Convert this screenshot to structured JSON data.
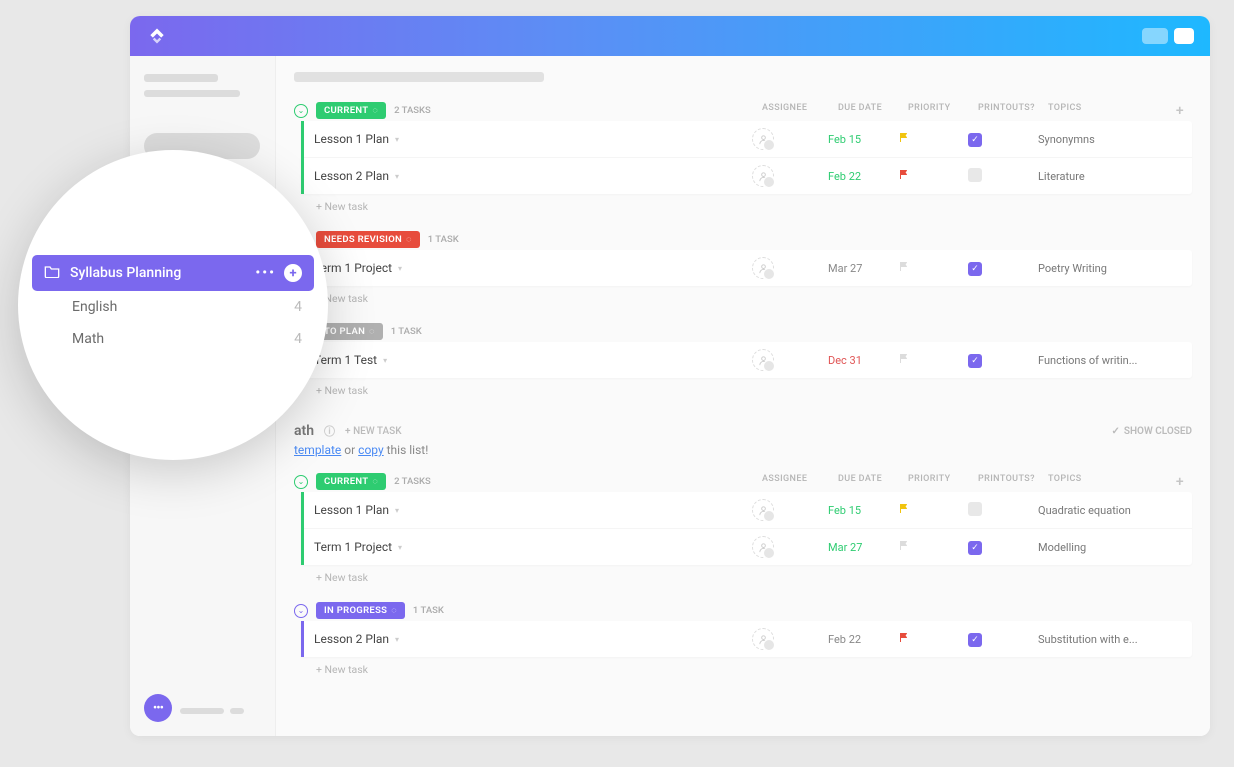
{
  "columns": {
    "assignee": "ASSIGNEE",
    "due_date": "DUE DATE",
    "priority": "PRIORITY",
    "printouts": "PRINTOUTS?",
    "topics": "TOPICS"
  },
  "newTaskLabel": "+ New task",
  "sections": [
    {
      "groups": [
        {
          "status": "CURRENT",
          "color": "#2ecc71",
          "taskCount": "2 TASKS",
          "tasks": [
            {
              "name": "Lesson 1 Plan",
              "due": "Feb 15",
              "dueColor": "#2ecc71",
              "flagColor": "#f1c40f",
              "printouts": true,
              "topic": "Synonymns"
            },
            {
              "name": "Lesson 2 Plan",
              "due": "Feb 22",
              "dueColor": "#2ecc71",
              "flagColor": "#e74c3c",
              "printouts": false,
              "topic": "Literature"
            }
          ]
        },
        {
          "status": "NEEDS REVISION",
          "color": "#e74c3c",
          "taskCount": "1 TASK",
          "tasks": [
            {
              "name": "Term 1 Project",
              "due": "Mar 27",
              "dueColor": "#888",
              "flagColor": "#dcdcdc",
              "printouts": true,
              "topic": "Poetry Writing"
            }
          ]
        },
        {
          "status": "TO PLAN",
          "color": "#b0b0b0",
          "taskCount": "1 TASK",
          "tasks": [
            {
              "name": "Term 1 Test",
              "due": "Dec 31",
              "dueColor": "#e05555",
              "flagColor": "#dcdcdc",
              "printouts": true,
              "topic": "Functions of writin..."
            }
          ]
        }
      ]
    },
    {
      "heading": "ath",
      "newTaskInline": "+ NEW TASK",
      "showClosed": "SHOW CLOSED",
      "hintTemplate": "template",
      "hintOr": " or ",
      "hintCopy": "copy",
      "hintRest": " this list!",
      "groups": [
        {
          "status": "CURRENT",
          "color": "#2ecc71",
          "taskCount": "2 TASKS",
          "tasks": [
            {
              "name": "Lesson 1 Plan",
              "due": "Feb 15",
              "dueColor": "#2ecc71",
              "flagColor": "#f1c40f",
              "printouts": false,
              "topic": "Quadratic equation"
            },
            {
              "name": "Term 1 Project",
              "due": "Mar 27",
              "dueColor": "#2ecc71",
              "flagColor": "#dcdcdc",
              "printouts": true,
              "topic": "Modelling"
            }
          ]
        },
        {
          "status": "IN PROGRESS",
          "color": "#7b68ee",
          "taskCount": "1 TASK",
          "tasks": [
            {
              "name": "Lesson 2 Plan",
              "due": "Feb 22",
              "dueColor": "#888",
              "flagColor": "#e74c3c",
              "printouts": true,
              "topic": "Substitution with e..."
            }
          ]
        }
      ]
    }
  ],
  "zoom": {
    "folder": "Syllabus Planning",
    "lists": [
      {
        "name": "English",
        "count": "4"
      },
      {
        "name": "Math",
        "count": "4"
      }
    ]
  }
}
